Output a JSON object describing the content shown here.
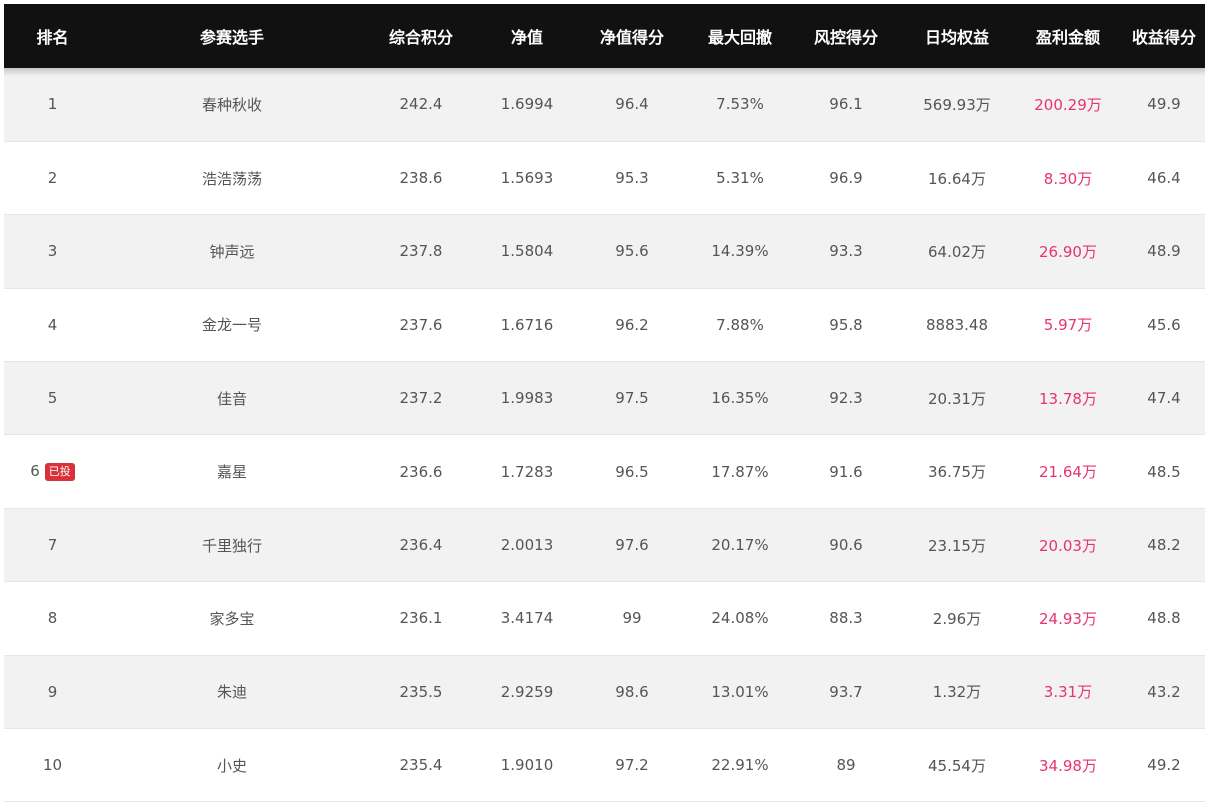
{
  "headers": [
    "排名",
    "参赛选手",
    "综合积分",
    "净值",
    "净值得分",
    "最大回撤",
    "风控得分",
    "日均权益",
    "盈利金额",
    "收益得分"
  ],
  "rows": [
    {
      "rank": "1",
      "badge": "",
      "name": "春种秋收",
      "score": "242.4",
      "nav": "1.6994",
      "nav_score": "96.4",
      "drawdown": "7.53%",
      "risk_score": "96.1",
      "avg_equity": "569.93万",
      "profit": "200.29万",
      "return_score": "49.9"
    },
    {
      "rank": "2",
      "badge": "",
      "name": "浩浩荡荡",
      "score": "238.6",
      "nav": "1.5693",
      "nav_score": "95.3",
      "drawdown": "5.31%",
      "risk_score": "96.9",
      "avg_equity": "16.64万",
      "profit": "8.30万",
      "return_score": "46.4"
    },
    {
      "rank": "3",
      "badge": "",
      "name": "钟声远",
      "score": "237.8",
      "nav": "1.5804",
      "nav_score": "95.6",
      "drawdown": "14.39%",
      "risk_score": "93.3",
      "avg_equity": "64.02万",
      "profit": "26.90万",
      "return_score": "48.9"
    },
    {
      "rank": "4",
      "badge": "",
      "name": "金龙一号",
      "score": "237.6",
      "nav": "1.6716",
      "nav_score": "96.2",
      "drawdown": "7.88%",
      "risk_score": "95.8",
      "avg_equity": "8883.48",
      "profit": "5.97万",
      "return_score": "45.6"
    },
    {
      "rank": "5",
      "badge": "",
      "name": "佳音",
      "score": "237.2",
      "nav": "1.9983",
      "nav_score": "97.5",
      "drawdown": "16.35%",
      "risk_score": "92.3",
      "avg_equity": "20.31万",
      "profit": "13.78万",
      "return_score": "47.4"
    },
    {
      "rank": "6",
      "badge": "已投",
      "name": "嘉星",
      "score": "236.6",
      "nav": "1.7283",
      "nav_score": "96.5",
      "drawdown": "17.87%",
      "risk_score": "91.6",
      "avg_equity": "36.75万",
      "profit": "21.64万",
      "return_score": "48.5"
    },
    {
      "rank": "7",
      "badge": "",
      "name": "千里独行",
      "score": "236.4",
      "nav": "2.0013",
      "nav_score": "97.6",
      "drawdown": "20.17%",
      "risk_score": "90.6",
      "avg_equity": "23.15万",
      "profit": "20.03万",
      "return_score": "48.2"
    },
    {
      "rank": "8",
      "badge": "",
      "name": "家多宝",
      "score": "236.1",
      "nav": "3.4174",
      "nav_score": "99",
      "drawdown": "24.08%",
      "risk_score": "88.3",
      "avg_equity": "2.96万",
      "profit": "24.93万",
      "return_score": "48.8"
    },
    {
      "rank": "9",
      "badge": "",
      "name": "朱迪",
      "score": "235.5",
      "nav": "2.9259",
      "nav_score": "98.6",
      "drawdown": "13.01%",
      "risk_score": "93.7",
      "avg_equity": "1.32万",
      "profit": "3.31万",
      "return_score": "43.2"
    },
    {
      "rank": "10",
      "badge": "",
      "name": "小史",
      "score": "235.4",
      "nav": "1.9010",
      "nav_score": "97.2",
      "drawdown": "22.91%",
      "risk_score": "89",
      "avg_equity": "45.54万",
      "profit": "34.98万",
      "return_score": "49.2"
    }
  ],
  "colors": {
    "header_bg": "#111111",
    "header_text": "#ffffff",
    "row_alt_bg": "#f2f2f2",
    "profit_text": "#e8336d",
    "badge_bg": "#d9303a"
  }
}
